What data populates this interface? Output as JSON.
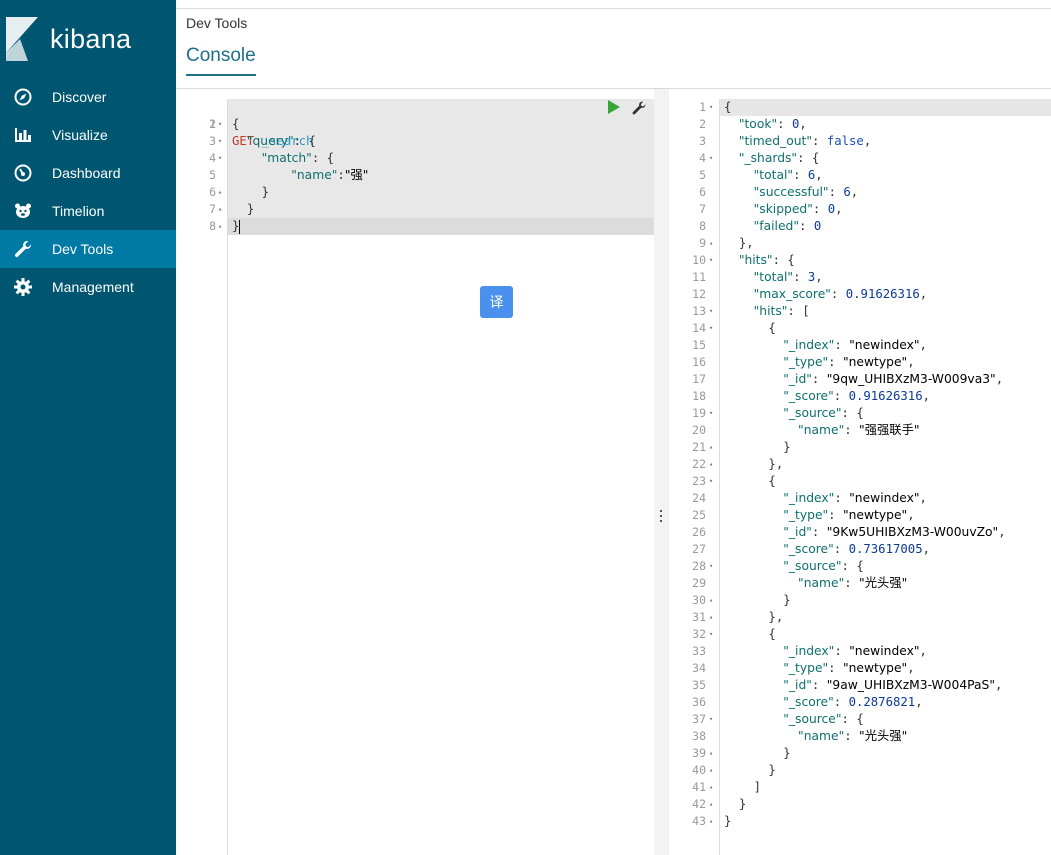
{
  "sidebar": {
    "brand": "kibana",
    "items": [
      {
        "label": "Discover",
        "icon": "compass-icon"
      },
      {
        "label": "Visualize",
        "icon": "bar-chart-icon"
      },
      {
        "label": "Dashboard",
        "icon": "gauge-icon"
      },
      {
        "label": "Timelion",
        "icon": "bear-icon"
      },
      {
        "label": "Dev Tools",
        "icon": "wrench-icon",
        "active": true
      },
      {
        "label": "Management",
        "icon": "gear-icon"
      }
    ]
  },
  "header": {
    "breadcrumb": "Dev Tools",
    "tab": "Console"
  },
  "translate_button": "译",
  "request": {
    "line_numbers": [
      "1",
      "2",
      "3",
      "4",
      "5",
      "6",
      "7",
      "8"
    ],
    "method": "GET",
    "path": "_search",
    "lines": [
      "{",
      "  \"query\": {",
      "    \"match\": {",
      "        \"name\":\"强\"",
      "    }",
      "  }",
      "}"
    ]
  },
  "response": {
    "lines": [
      "{",
      "  \"took\": 0,",
      "  \"timed_out\": false,",
      "  \"_shards\": {",
      "    \"total\": 6,",
      "    \"successful\": 6,",
      "    \"skipped\": 0,",
      "    \"failed\": 0",
      "  },",
      "  \"hits\": {",
      "    \"total\": 3,",
      "    \"max_score\": 0.91626316,",
      "    \"hits\": [",
      "      {",
      "        \"_index\": \"newindex\",",
      "        \"_type\": \"newtype\",",
      "        \"_id\": \"9qw_UHIBXzM3-W009va3\",",
      "        \"_score\": 0.91626316,",
      "        \"_source\": {",
      "          \"name\": \"强强联手\"",
      "        }",
      "      },",
      "      {",
      "        \"_index\": \"newindex\",",
      "        \"_type\": \"newtype\",",
      "        \"_id\": \"9Kw5UHIBXzM3-W00uvZo\",",
      "        \"_score\": 0.73617005,",
      "        \"_source\": {",
      "          \"name\": \"光头强\"",
      "        }",
      "      },",
      "      {",
      "        \"_index\": \"newindex\",",
      "        \"_type\": \"newtype\",",
      "        \"_id\": \"9aw_UHIBXzM3-W004PaS\",",
      "        \"_score\": 0.2876821,",
      "        \"_source\": {",
      "          \"name\": \"光头强\"",
      "        }",
      "      }",
      "    ]",
      "  }",
      "}"
    ]
  },
  "colors": {
    "sidebar_bg": "#005571",
    "sidebar_active": "#0079a5",
    "tab_accent": "#1e6f8a",
    "run_green": "#3aa53a",
    "translate_blue": "#4a90ef"
  }
}
